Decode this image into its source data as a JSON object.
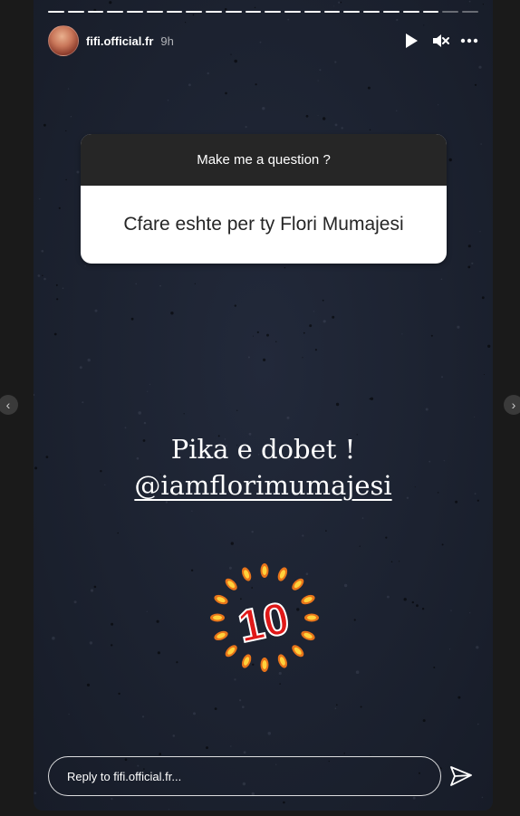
{
  "progress": {
    "total_segments": 22,
    "completed_segments": 20
  },
  "header": {
    "username": "fifi.official.fr",
    "time_ago": "9h",
    "icons": [
      "play-icon",
      "mute-icon",
      "more-options-icon"
    ]
  },
  "question_sticker": {
    "prompt": "Make me a question ?",
    "answer": "Cfare eshte per ty Flori Mumajesi"
  },
  "story_text": {
    "line1": "Pika e dobet !",
    "mention": "@iamflorimumajesi"
  },
  "score_sticker": {
    "value": "10"
  },
  "reply": {
    "placeholder": "Reply to fifi.official.fr..."
  },
  "colors": {
    "story_bg": "#1c2230",
    "sticker_red": "#e01818",
    "flame": "#f5a623"
  }
}
